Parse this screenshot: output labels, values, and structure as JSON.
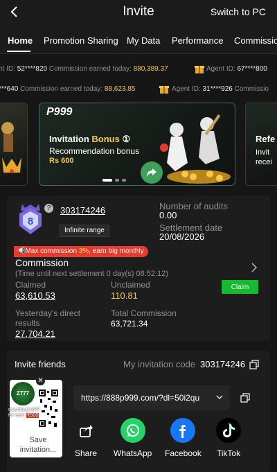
{
  "header": {
    "title": "Invite",
    "switch_label": "Switch to PC"
  },
  "tabs": [
    "Home",
    "Promotion Sharing",
    "My Data",
    "Performance",
    "Commissio"
  ],
  "ticker_rows": [
    {
      "items": [
        {
          "label": "nt ID: ",
          "id": "52****820",
          "text": " Commission earned today: ",
          "amount": "880,389.37"
        },
        {
          "label": "Agent ID: ",
          "id": "67****800"
        }
      ]
    },
    {
      "items": [
        {
          "label": "",
          "id": "***640",
          "text": " Commission earned today: ",
          "amount": "88,623.85"
        },
        {
          "label": "Agent ID: ",
          "id": "31****926",
          "text": " Commissio"
        }
      ]
    }
  ],
  "banner": {
    "logo": "P999",
    "title_prefix": "Invitation",
    "title_highlight": "Bonus",
    "title_badge": "①",
    "subtitle": "Recommendation bonus",
    "amount": "Rs 600",
    "right_title": "Refe",
    "right_sub1": "Invit",
    "right_sub2": "recei"
  },
  "agent": {
    "level": "8",
    "id": "303174246",
    "range": "Infinite range",
    "audits_label": "Number of audits",
    "audits_value": "0.00",
    "settlement_label": "Settlement date",
    "settlement_value": "20/08/2026"
  },
  "promo": {
    "prefix": "Max commission ",
    "pct": "3%",
    "suffix": ", earn big monthly"
  },
  "commission": {
    "title": "Commission",
    "countdown": "(Time until next settlement   0 day(s) 08:52:12)",
    "claimed_label": "Claimed",
    "claimed_value": "63,610.53",
    "unclaimed_label": "Unclaimed",
    "unclaimed_value": "110.81",
    "claim_button": "Claim",
    "yesterday_label_1": "Yesterday's direct",
    "yesterday_label_2": "results",
    "yesterday_value": "27,704.21",
    "total_label": "Total Commission",
    "total_value": "63,721.34"
  },
  "invite": {
    "title": "Invite friends",
    "code_label": "My invitation code",
    "code_value": "303174246",
    "link": "https://888p999.com/?dl=50i2qu"
  },
  "share": [
    {
      "label": "Share",
      "icon": "share-icon"
    },
    {
      "label": "WhatsApp",
      "icon": "whatsapp-icon",
      "color": "#25d366"
    },
    {
      "label": "Facebook",
      "icon": "facebook-icon",
      "color": "#1877f2"
    },
    {
      "label": "TikTok",
      "icon": "tiktok-icon",
      "color": "#000000"
    }
  ],
  "float_widget": {
    "logo": "Z777",
    "caption_1": "download APP",
    "caption_2": "for earn",
    "caption_amount": "₹500",
    "save_label": "Save invitation..."
  },
  "colors": {
    "gold": "#f5c84a",
    "claim_green": "#17b931",
    "promo_red": "#e63a2e"
  }
}
